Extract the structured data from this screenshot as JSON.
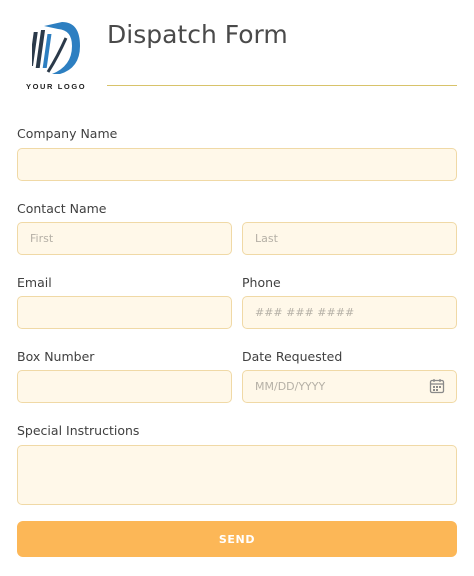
{
  "logo": {
    "text": "YOUR LOGO"
  },
  "form": {
    "title": "Dispatch Form",
    "company": {
      "label": "Company Name",
      "value": ""
    },
    "contact": {
      "label": "Contact Name",
      "first_placeholder": "First",
      "last_placeholder": "Last"
    },
    "email": {
      "label": "Email",
      "value": ""
    },
    "phone": {
      "label": "Phone",
      "placeholder": "### ### ####"
    },
    "box": {
      "label": "Box Number",
      "value": ""
    },
    "date": {
      "label": "Date Requested",
      "placeholder": "MM/DD/YYYY",
      "icon": "calendar-icon"
    },
    "instructions": {
      "label": "Special Instructions",
      "value": ""
    },
    "send_label": "SEND"
  },
  "colors": {
    "field_bg": "#fff8e9",
    "field_border": "#f0d9a6",
    "button_bg": "#fcb757",
    "rule": "#d8c36a",
    "logo_blue": "#2d7fc1",
    "logo_dark": "#2b3a4a"
  }
}
